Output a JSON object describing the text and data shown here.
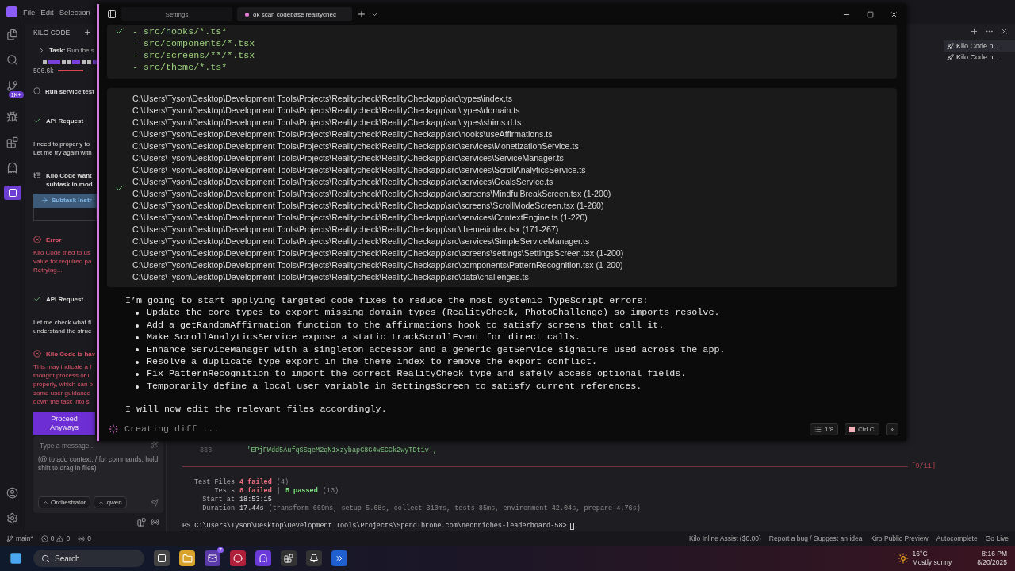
{
  "menu": [
    "File",
    "Edit",
    "Selection"
  ],
  "activity_bar": {
    "badge": "1K+"
  },
  "sidebar": {
    "title": "KILO CODE",
    "add": "+",
    "task": {
      "label": "Task:",
      "text": "Run the s"
    },
    "tokens": "506.6k",
    "messages": [
      {
        "kind": "todo",
        "title": "Run service test"
      },
      {
        "kind": "api",
        "title": "API Request"
      },
      {
        "kind": "text",
        "lines": [
          "I need to properly fo",
          "Let me try again with"
        ]
      },
      {
        "kind": "ask",
        "lines": [
          "Kilo Code want",
          "subtask in mod"
        ]
      },
      {
        "kind": "link",
        "text": "Subtask Instr"
      },
      {
        "kind": "error",
        "title": "Error",
        "lines": [
          "Kilo Code tried to us",
          "value for required pa",
          "Retrying..."
        ]
      },
      {
        "kind": "api",
        "title": "API Request"
      },
      {
        "kind": "text",
        "lines": [
          "Let me check what fi",
          "understand the struc"
        ]
      },
      {
        "kind": "error",
        "title": "Kilo Code is hav",
        "lines": [
          "This may indicate a f",
          "thought process or i",
          "properly, which can b",
          "some user guidance",
          "down the task into s"
        ]
      }
    ],
    "proceed": "Proceed Anyways",
    "composer": {
      "placeholder": "Type a message...",
      "hint": "(@ to add context, / for commands, hold shift to drag in files)",
      "mode": "Orchestrator",
      "model": "qwen"
    }
  },
  "assistant_window": {
    "tabs": [
      {
        "label": "Settings",
        "selected": false
      },
      {
        "label": "ok scan codebase realitychec",
        "selected": true
      }
    ],
    "code_block": {
      "done": true,
      "lines": [
        "- src/hooks/*.ts*",
        "- src/components/*.tsx",
        "- src/screens/**/*.tsx",
        "- src/theme/*.ts*"
      ]
    },
    "file_list": {
      "done": true,
      "files": [
        "C:\\Users\\Tyson\\Desktop\\Development Tools\\Projects\\Realitycheck\\RealityCheckapp\\src\\types\\index.ts",
        "C:\\Users\\Tyson\\Desktop\\Development Tools\\Projects\\Realitycheck\\RealityCheckapp\\src\\types\\domain.ts",
        "C:\\Users\\Tyson\\Desktop\\Development Tools\\Projects\\Realitycheck\\RealityCheckapp\\src\\types\\shims.d.ts",
        "C:\\Users\\Tyson\\Desktop\\Development Tools\\Projects\\Realitycheck\\RealityCheckapp\\src\\hooks\\useAffirmations.ts",
        "C:\\Users\\Tyson\\Desktop\\Development Tools\\Projects\\Realitycheck\\RealityCheckapp\\src\\services\\MonetizationService.ts",
        "C:\\Users\\Tyson\\Desktop\\Development Tools\\Projects\\Realitycheck\\RealityCheckapp\\src\\services\\ServiceManager.ts",
        "C:\\Users\\Tyson\\Desktop\\Development Tools\\Projects\\Realitycheck\\RealityCheckapp\\src\\services\\ScrollAnalyticsService.ts",
        "C:\\Users\\Tyson\\Desktop\\Development Tools\\Projects\\Realitycheck\\RealityCheckapp\\src\\services\\GoalsService.ts",
        "C:\\Users\\Tyson\\Desktop\\Development Tools\\Projects\\Realitycheck\\RealityCheckapp\\src\\screens\\MindfulBreakScreen.tsx (1-200)",
        "C:\\Users\\Tyson\\Desktop\\Development Tools\\Projects\\Realitycheck\\RealityCheckapp\\src\\screens\\ScrollModeScreen.tsx (1-260)",
        "C:\\Users\\Tyson\\Desktop\\Development Tools\\Projects\\Realitycheck\\RealityCheckapp\\src\\services\\ContextEngine.ts (1-220)",
        "C:\\Users\\Tyson\\Desktop\\Development Tools\\Projects\\Realitycheck\\RealityCheckapp\\src\\theme\\index.tsx (171-267)",
        "C:\\Users\\Tyson\\Desktop\\Development Tools\\Projects\\Realitycheck\\RealityCheckapp\\src\\services\\SimpleServiceManager.ts",
        "C:\\Users\\Tyson\\Desktop\\Development Tools\\Projects\\Realitycheck\\RealityCheckapp\\src\\screens\\settings\\SettingsScreen.tsx (1-200)",
        "C:\\Users\\Tyson\\Desktop\\Development Tools\\Projects\\Realitycheck\\RealityCheckapp\\src\\components\\PatternRecognition.tsx (1-200)",
        "C:\\Users\\Tyson\\Desktop\\Development Tools\\Projects\\Realitycheck\\RealityCheckapp\\src\\data\\challenges.ts"
      ]
    },
    "message": {
      "intro": "I’m going to start applying targeted code fixes to reduce the most systemic TypeScript errors:",
      "bullets": [
        "Update the core types to export missing domain types (RealityCheck, PhotoChallenge) so imports resolve.",
        "Add a getRandomAffirmation function to the affirmations hook to satisfy screens that call it.",
        "Make ScrollAnalyticsService expose a static trackScrollEvent for direct calls.",
        "Enhance ServiceManager with a singleton accessor and a generic getService signature used across the app.",
        "Resolve a duplicate type export in the theme index to remove the export conflict.",
        "Fix PatternRecognition to import the correct RealityCheck type and safely access optional fields.",
        "Temporarily define a local user variable in SettingsScreen to satisfy current references."
      ],
      "outro": "I will now edit the relevant files accordingly."
    },
    "status": "Creating diff ...",
    "counter": "1/8",
    "stop": "Ctrl C",
    "more": "»"
  },
  "terminal": {
    "line_number": "333",
    "code": "'EPjFWdd5AufqSSqeM2qN1xzybapC8G4wEGGk2wyTDt1v',",
    "progress": "[9/11]",
    "summary": [
      {
        "label": "Test Files",
        "parts": [
          {
            "kind": "fail",
            "text": "4 failed"
          },
          {
            "kind": "muted",
            "text": "(4)"
          }
        ]
      },
      {
        "label": "Tests",
        "parts": [
          {
            "kind": "fail",
            "text": "8 failed"
          },
          {
            "kind": "muted",
            "text": "|"
          },
          {
            "kind": "pass",
            "text": "5 passed"
          },
          {
            "kind": "muted",
            "text": "(13)"
          }
        ]
      },
      {
        "label": "Start at",
        "parts": [
          {
            "kind": "plain",
            "text": "18:53:15"
          }
        ]
      },
      {
        "label": "Duration",
        "parts": [
          {
            "kind": "plain",
            "text": "17.44s"
          },
          {
            "kind": "muted",
            "text": "(transform 669ms, setup 5.68s, collect 310ms, tests 85ms, environment 42.04s, prepare 4.76s)"
          }
        ]
      }
    ],
    "prompt": "PS C:\\Users\\Tyson\\Desktop\\Development Tools\\Projects\\SpendThrone.com\\neonriches-leaderboard-58>"
  },
  "right_panel": {
    "items": [
      "Kilo Code n...",
      "Kilo Code n..."
    ]
  },
  "status_bar": {
    "branch": "main*",
    "errors": "0",
    "warnings": "0",
    "ports": "0",
    "right": [
      "Kilo Inline Assist ($0.00)",
      "Report a bug / Suggest an idea",
      "Kiro Public Preview",
      "Autocomplete",
      "Go Live"
    ]
  },
  "taskbar": {
    "search": "Search",
    "mail_badge": "7",
    "temperature": "16°C",
    "weather": "Mostly sunny",
    "time": "8:16 PM",
    "date": "8/20/2025"
  }
}
